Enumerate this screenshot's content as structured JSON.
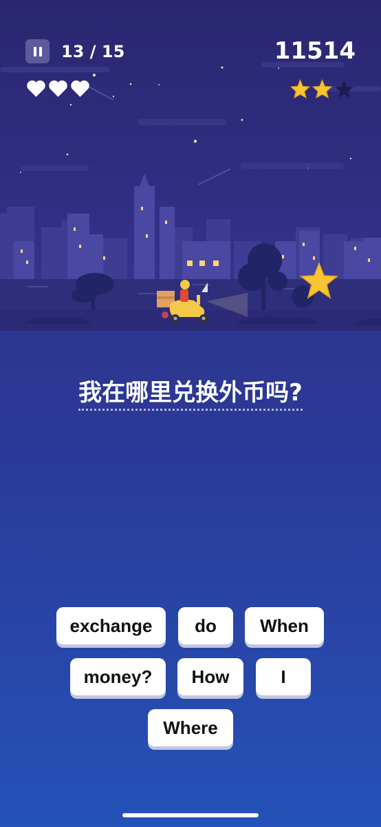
{
  "hud": {
    "progress": "13 / 15",
    "score": "11514",
    "hearts": 3,
    "stars_earned": 2,
    "stars_total": 3,
    "pause_icon": "pause-icon"
  },
  "question": {
    "prompt": "我在哪里兑换外币吗?"
  },
  "word_bank": {
    "words": [
      "exchange",
      "do",
      "When",
      "money?",
      "How",
      "I",
      "Where"
    ]
  },
  "colors": {
    "star": "#f7c531",
    "heart": "#ffffff",
    "background_top": "#2e2c78",
    "background_bottom": "#2452b8"
  }
}
